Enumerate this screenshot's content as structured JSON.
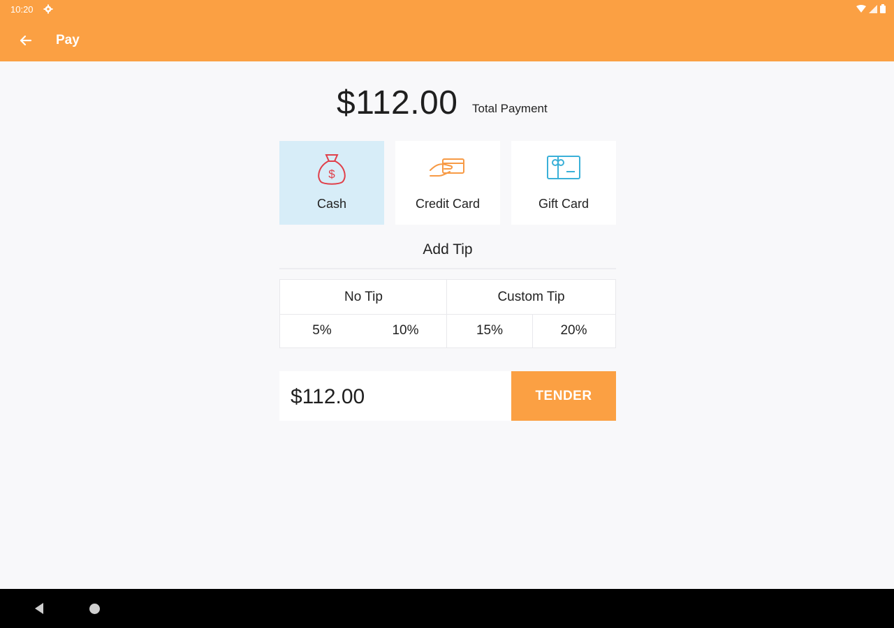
{
  "status_bar": {
    "time": "10:20"
  },
  "app_bar": {
    "title": "Pay",
    "back_icon": "arrow-left-icon"
  },
  "total": {
    "amount": "$112.00",
    "label": "Total Payment"
  },
  "payment_methods": [
    {
      "label": "Cash",
      "icon": "money-bag-icon",
      "selected": true
    },
    {
      "label": "Credit Card",
      "icon": "hand-card-icon",
      "selected": false
    },
    {
      "label": "Gift Card",
      "icon": "gift-card-icon",
      "selected": false
    }
  ],
  "tip": {
    "heading": "Add Tip",
    "no_tip": "No Tip",
    "custom_tip": "Custom Tip",
    "percentages": [
      "5%",
      "10%",
      "15%",
      "20%"
    ]
  },
  "tender": {
    "amount": "$112.00",
    "button": "TENDER"
  },
  "colors": {
    "accent": "#fba043",
    "selected": "#d7edf8",
    "cash_icon": "#e0404a",
    "card_icon": "#f79a45",
    "gift_icon": "#3ab0d8"
  }
}
